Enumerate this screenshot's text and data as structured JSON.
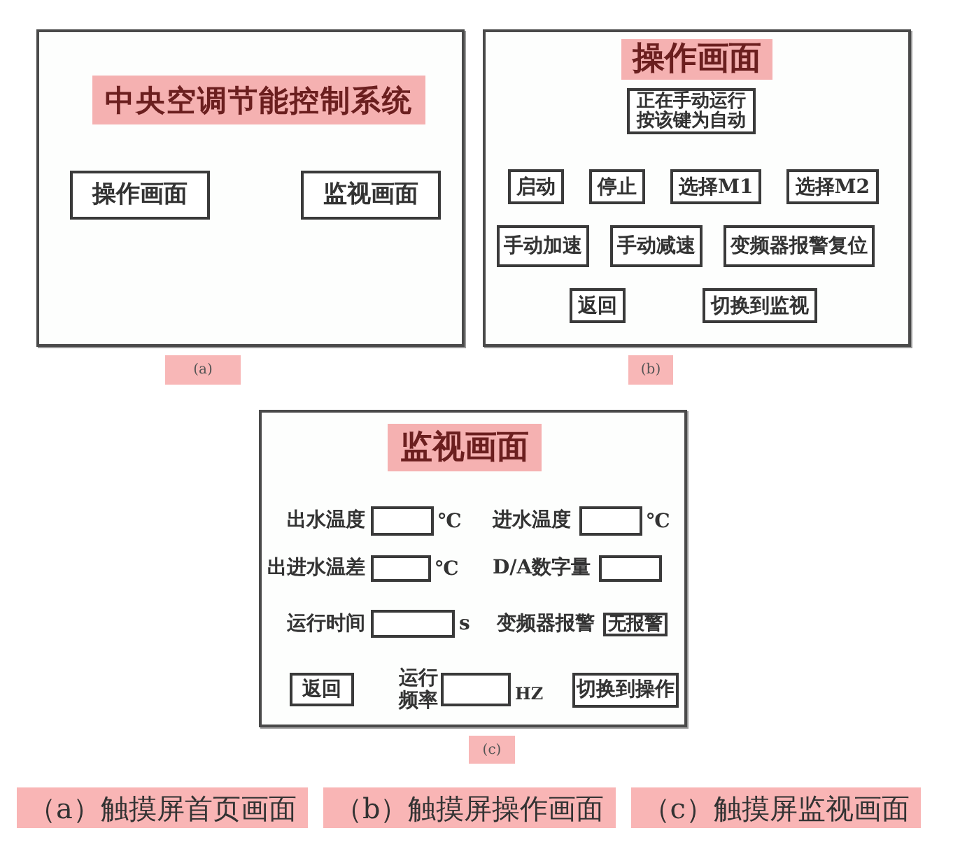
{
  "panels": [
    {
      "kind": "home",
      "caption": "(a)",
      "title": "中央空调节能控制系统",
      "buttons": [
        "操作画面",
        "监视画面"
      ]
    },
    {
      "kind": "operation",
      "caption": "(b)",
      "title": "操作画面",
      "mode_button": "正在手动运行按该键为自动",
      "button_rows": [
        [
          "启动",
          "停止",
          "选择M1",
          "选择M2"
        ],
        [
          "手动加速",
          "手动减速",
          "变频器报警复位"
        ],
        [
          "返回",
          "切换到监视"
        ]
      ]
    },
    {
      "kind": "monitor",
      "caption": "(c)",
      "title": "监视画面",
      "rows": [
        [
          {
            "kind": "field",
            "label": "出水温度",
            "unit": "℃"
          },
          {
            "kind": "field",
            "label": "进水温度",
            "unit": "℃"
          }
        ],
        [
          {
            "kind": "field",
            "label": "出进水温差",
            "unit": "℃"
          },
          {
            "kind": "field",
            "label": "D/A数字量"
          }
        ],
        [
          {
            "kind": "field",
            "label": "运行时间",
            "unit": "s"
          },
          {
            "kind": "indicator",
            "label": "变频器报警",
            "value": "无报警"
          }
        ]
      ],
      "footer": [
        {
          "kind": "button",
          "label": "返回"
        },
        {
          "kind": "field",
          "label": "运行频率",
          "unit": "HZ"
        },
        {
          "kind": "button",
          "label": "切换到操作"
        }
      ]
    }
  ],
  "figure_captions": [
    "（a）触摸屏首页画面",
    "（b）触摸屏操作画面",
    "（c）触摸屏监视画面"
  ]
}
